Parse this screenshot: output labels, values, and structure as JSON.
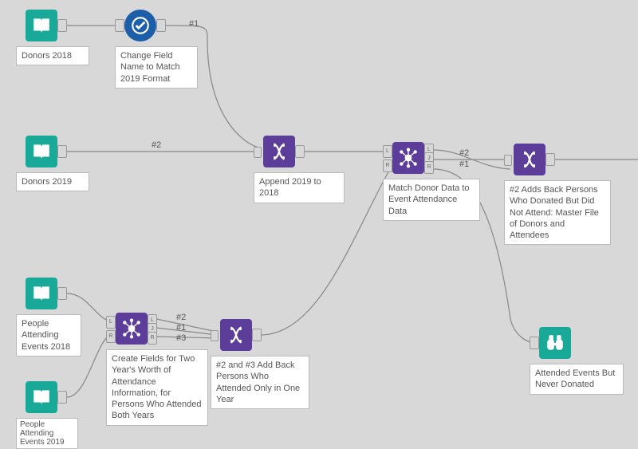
{
  "nodes": {
    "donors2018": {
      "label": "Donors 2018"
    },
    "donors2019": {
      "label": "Donors 2019"
    },
    "changeField": {
      "label": "Change Field Name to Match 2019 Format"
    },
    "append": {
      "label": "Append 2019 to 2018"
    },
    "matchDonor": {
      "label": "Match Donor Data to Event Attendance Data"
    },
    "unionAddBack": {
      "label": "#2 Adds Back Persons Who Donated But Did Not Attend: Master File of Donors and Attendees"
    },
    "attending2018": {
      "label": "People Attending Events 2018"
    },
    "attending2019": {
      "label": "People Attending Events 2019"
    },
    "createFields": {
      "label": "Create Fields for Two Year's Worth of Attendance Information, for Persons Who Attended Both Years"
    },
    "addBackOneYear": {
      "label": "#2 and #3 Add Back Persons Who Attended Only in One Year"
    },
    "attendedNever": {
      "label": "Attended Events But Never Donated"
    }
  },
  "anchors": {
    "L": "L",
    "R": "R",
    "J": "J"
  },
  "wireLabels": {
    "w1": "#1",
    "w2": "#2",
    "w3": "#1",
    "w4": "#2",
    "w5": "#2",
    "w6": "#1",
    "w7": "#3"
  },
  "colors": {
    "inputTool": "#18a999",
    "prepTool": "#1c5ea8",
    "joinTool": "#5c3d99",
    "canvas": "#d8d8d8"
  }
}
